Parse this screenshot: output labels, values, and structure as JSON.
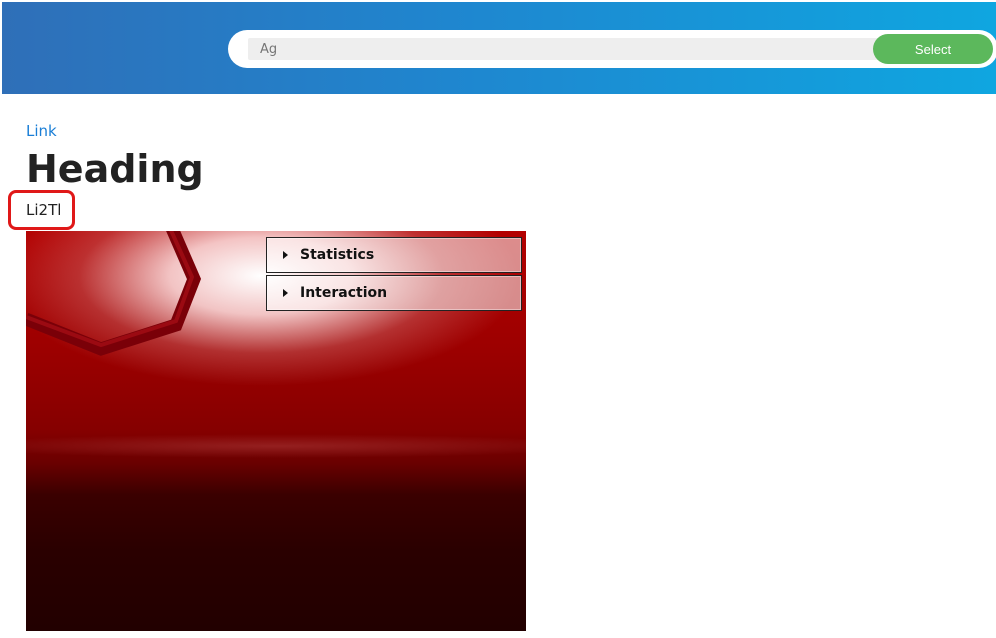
{
  "header": {
    "search_placeholder": "Ag",
    "select_label": "Select",
    "colors": {
      "bar_start": "#2f6fb8",
      "bar_end": "#0fa6e0",
      "select_button": "#5cb85c"
    }
  },
  "main": {
    "link": "Link",
    "heading": "Heading",
    "subtitle": "Li2Tl",
    "highlight_color": "#e01818"
  },
  "viewer": {
    "panels": [
      {
        "label": "Statistics",
        "icon": "caret-right-icon"
      },
      {
        "label": "Interaction",
        "icon": "caret-right-icon"
      }
    ]
  }
}
